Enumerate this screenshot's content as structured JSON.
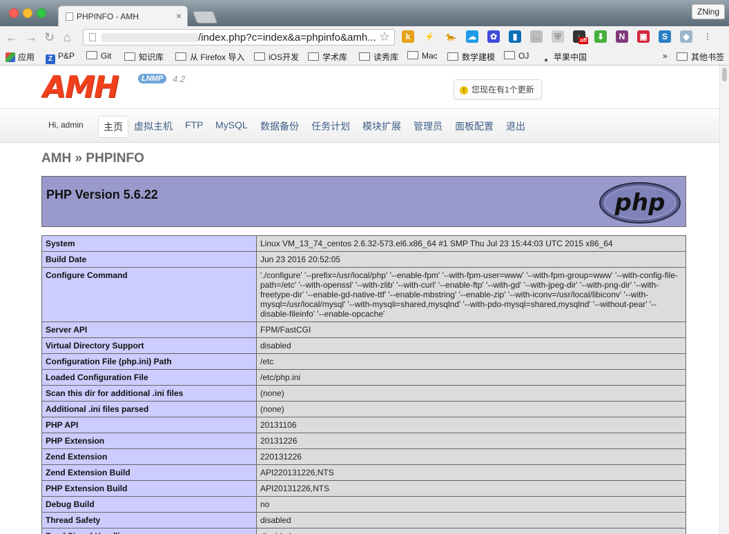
{
  "browser": {
    "tab_title": "PHPINFO - AMH",
    "tab_close": "×",
    "profile_name": "ZNing",
    "url": "/index.php?c=index&a=phpinfo&amh...",
    "star_icon": "☆"
  },
  "extensions": [
    {
      "icon": "k-extension-icon",
      "glyph": "k",
      "color": "#e8a21a"
    },
    {
      "icon": "bolt-icon",
      "glyph": "⚡",
      "color": "#f1f1f1"
    },
    {
      "icon": "fox-icon",
      "glyph": "🐆",
      "color": "#f1f1f1"
    },
    {
      "icon": "cloud-icon",
      "glyph": "☁",
      "color": "#1e9be8"
    },
    {
      "icon": "paw-icon",
      "glyph": "✿",
      "color": "#3f4bd9"
    },
    {
      "icon": "bookmark-icon",
      "glyph": "▮",
      "color": "#0b6fb8"
    },
    {
      "icon": "chat-icon",
      "glyph": "…",
      "color": "#bdbdbd"
    },
    {
      "icon": "shield-icon",
      "glyph": "⛨",
      "color": "#cfcfcf"
    },
    {
      "icon": "download-off-icon",
      "glyph": "↓",
      "color": "#333333",
      "badge": "off"
    },
    {
      "icon": "arrow-down-icon",
      "glyph": "⬇",
      "color": "#45b03a"
    },
    {
      "icon": "onenote-icon",
      "glyph": "N",
      "color": "#80397b"
    },
    {
      "icon": "pocket-icon",
      "glyph": "▣",
      "color": "#d3263d"
    },
    {
      "icon": "s-icon",
      "glyph": "S",
      "color": "#2a7fc4"
    },
    {
      "icon": "dropbox-icon",
      "glyph": "◆",
      "color": "#9db5c8"
    },
    {
      "icon": "menu-icon",
      "glyph": "⋮",
      "color": "#f1f1f1"
    }
  ],
  "bookmarks": [
    {
      "label": "应用",
      "icon": "apps-icon"
    },
    {
      "label": "P&P",
      "icon": "z-icon"
    },
    {
      "label": "Git",
      "icon": "folder-icon"
    },
    {
      "label": "知识库",
      "icon": "folder-icon"
    },
    {
      "label": "从 Firefox 导入",
      "icon": "folder-icon"
    },
    {
      "label": "iOS开发",
      "icon": "folder-icon"
    },
    {
      "label": "学术库",
      "icon": "folder-icon"
    },
    {
      "label": "读秀库",
      "icon": "folder-icon"
    },
    {
      "label": "Mac",
      "icon": "folder-icon"
    },
    {
      "label": "数学建模",
      "icon": "folder-icon"
    },
    {
      "label": "OJ",
      "icon": "folder-icon"
    },
    {
      "label": "苹果中国",
      "icon": "apple-icon"
    }
  ],
  "bookmarks_more": "»",
  "bookmarks_other": "其他书签",
  "amh": {
    "logo": "AMH",
    "badge": "LNMP",
    "version": "4.2",
    "update_notice": "您现在有1个更新",
    "greeting": "Hi, admin",
    "nav": [
      "主页",
      "虚拟主机",
      "FTP",
      "MySQL",
      "数据备份",
      "任务计划",
      "模块扩展",
      "管理员",
      "面板配置",
      "退出"
    ],
    "breadcrumb": "AMH » PHPINFO"
  },
  "phpinfo": {
    "version_title": "PHP Version 5.6.22",
    "logo_text": "php",
    "rows": [
      {
        "key": "System",
        "value": "Linux VM_13_74_centos 2.6.32-573.el6.x86_64 #1 SMP Thu Jul 23 15:44:03 UTC 2015 x86_64"
      },
      {
        "key": "Build Date",
        "value": "Jun 23 2016 20:52:05"
      },
      {
        "key": "Configure Command",
        "value": "'./configure' '--prefix=/usr/local/php' '--enable-fpm' '--with-fpm-user=www' '--with-fpm-group=www' '--with-config-file-path=/etc' '--with-openssl' '--with-zlib' '--with-curl' '--enable-ftp' '--with-gd' '--with-jpeg-dir' '--with-png-dir' '--with-freetype-dir' '--enable-gd-native-ttf' '--enable-mbstring' '--enable-zip' '--with-iconv=/usr/local/libiconv' '--with-mysql=/usr/local/mysql' '--with-mysqli=shared,mysqlnd' '--with-pdo-mysql=shared,mysqlnd' '--without-pear' '--disable-fileinfo' '--enable-opcache'"
      },
      {
        "key": "Server API",
        "value": "FPM/FastCGI"
      },
      {
        "key": "Virtual Directory Support",
        "value": "disabled"
      },
      {
        "key": "Configuration File (php.ini) Path",
        "value": "/etc"
      },
      {
        "key": "Loaded Configuration File",
        "value": "/etc/php.ini"
      },
      {
        "key": "Scan this dir for additional .ini files",
        "value": "(none)"
      },
      {
        "key": "Additional .ini files parsed",
        "value": "(none)"
      },
      {
        "key": "PHP API",
        "value": "20131106"
      },
      {
        "key": "PHP Extension",
        "value": "20131226"
      },
      {
        "key": "Zend Extension",
        "value": "220131226"
      },
      {
        "key": "Zend Extension Build",
        "value": "API220131226,NTS"
      },
      {
        "key": "PHP Extension Build",
        "value": "API20131226,NTS"
      },
      {
        "key": "Debug Build",
        "value": "no"
      },
      {
        "key": "Thread Safety",
        "value": "disabled"
      },
      {
        "key": "Zend Signal Handling",
        "value": "disabled"
      }
    ]
  }
}
